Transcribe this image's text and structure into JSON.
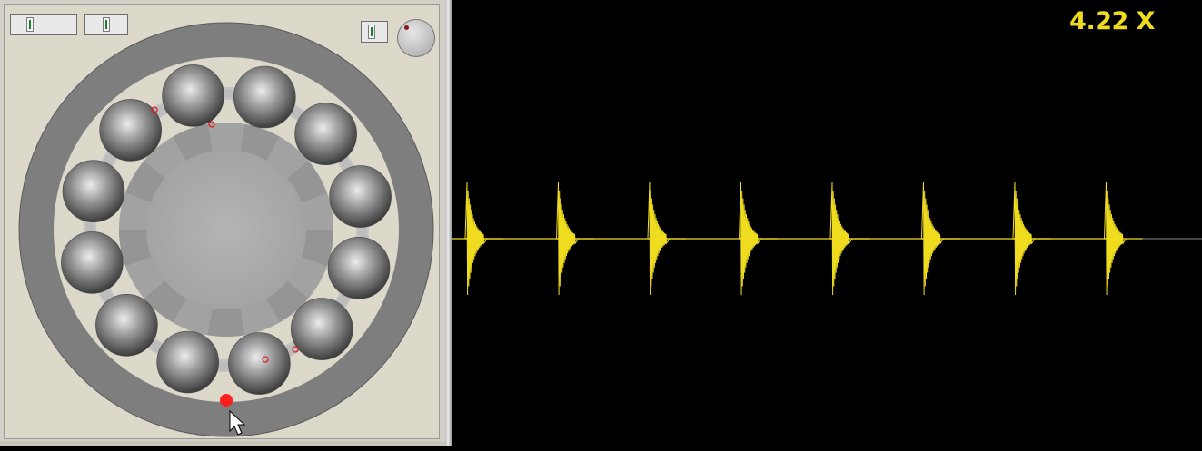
{
  "speed_multiplier": "4.22 X",
  "colors": {
    "panel_bg": "#dcd9cb",
    "outer_race": "#808080",
    "inner_race": "#a6a6a6",
    "ball": "#6a6a6a",
    "defect_marker": "#ff1e1e",
    "waveform": "#f0dc1e",
    "scope_bg": "#000000",
    "baseline": "#8a8a8a"
  },
  "controls": {
    "slider_1": "slider",
    "slider_2": "slider",
    "slider_3": "slider",
    "knob": "rotation-dial"
  },
  "bearing": {
    "ball_count": 12
  },
  "waveform": {
    "burst_count": 8
  }
}
